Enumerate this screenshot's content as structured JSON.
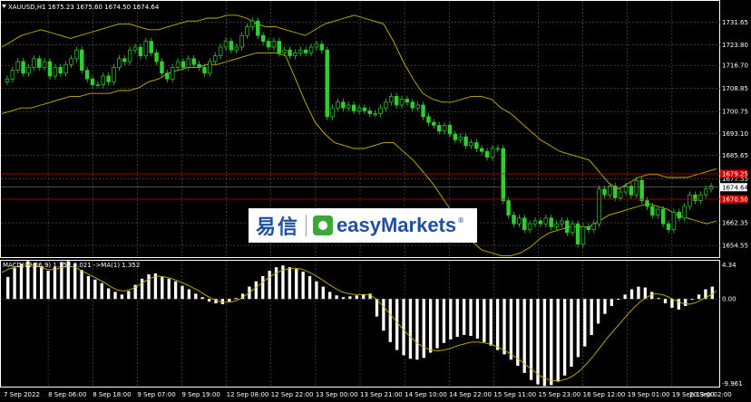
{
  "header": {
    "symbol_line": "XAUUSD,H1  1675.23 1675.60 1674.50 1674.64",
    "macd_line": "MACD(12,26,9) 1.352 0.021  ->MA(1) 1.352"
  },
  "logo": {
    "cn": "易信",
    "en": "easyMarkets",
    "reg": "®"
  },
  "colors": {
    "background": "#000000",
    "grid": "#5a5a5a",
    "candle": "#33cc33",
    "band": "#c8b400",
    "macd_hist": "#ffffff",
    "signal": "#c8b400",
    "hline": "#d40000",
    "price_label": "#ffffff",
    "red_label_bg": "#cc0000"
  },
  "price_axis_labels": [
    "1731.65",
    "1723.80",
    "1716.70",
    "1708.85",
    "1700.75",
    "1693.10",
    "1685.65",
    "1677.55",
    "1662.35",
    "1654.55"
  ],
  "price_tags": [
    {
      "value": "1679.25",
      "style": "red"
    },
    {
      "value": "1674.64",
      "style": "white"
    },
    {
      "value": "1670.50",
      "style": "red"
    }
  ],
  "macd_axis_labels": [
    "4.34",
    "0.00",
    "-9.961"
  ],
  "time_labels": [
    "7 Sep 2022",
    "8 Sep 06:00",
    "8 Sep 18:00",
    "9 Sep 07:00",
    "9 Sep 19:00",
    "12 Sep 08:00",
    "12 Sep 22:00",
    "13 Sep 00:00",
    "13 Sep 21:00",
    "14 Sep 10:00",
    "14 Sep 22:00",
    "15 Sep 11:00",
    "15 Sep 23:00",
    "16 Sep 12:00",
    "19 Sep 01:00",
    "19 Sep 13:00",
    "20 Sep 02:00"
  ],
  "chart_data": [
    {
      "type": "candlestick",
      "title": "XAUUSD,H1",
      "ylim": [
        1650.5,
        1735.5
      ],
      "grid": true,
      "horizontal_lines": [
        1679.25,
        1670.5
      ],
      "close": [
        1712,
        1715,
        1718,
        1714,
        1716,
        1719,
        1716,
        1718,
        1713,
        1716,
        1714,
        1717,
        1719,
        1722,
        1715,
        1712,
        1710,
        1710,
        1713,
        1711,
        1716,
        1719,
        1718,
        1722,
        1723,
        1720,
        1725,
        1721,
        1718,
        1714,
        1712,
        1716,
        1718,
        1716,
        1719,
        1717,
        1716,
        1714,
        1718,
        1720,
        1723,
        1725,
        1722,
        1723,
        1727,
        1730,
        1732,
        1727,
        1725,
        1723,
        1725,
        1721,
        1722,
        1720,
        1721,
        1722,
        1721,
        1723,
        1724,
        1722,
        1699,
        1702,
        1704,
        1702,
        1703,
        1701,
        1702,
        1701,
        1700,
        1700,
        1702,
        1704,
        1706,
        1703,
        1705,
        1704,
        1702,
        1703,
        1699,
        1697,
        1696,
        1694,
        1696,
        1693,
        1691,
        1692,
        1689,
        1690,
        1688,
        1687,
        1685,
        1688,
        1688,
        1670,
        1665,
        1662,
        1664,
        1660,
        1662,
        1663,
        1662,
        1664,
        1661,
        1662,
        1663,
        1659,
        1662,
        1655,
        1661,
        1660,
        1662,
        1674,
        1672,
        1675,
        1671,
        1673,
        1675,
        1672,
        1677,
        1670,
        1668,
        1665,
        1667,
        1662,
        1660,
        1666,
        1664,
        1668,
        1672,
        1670,
        1672,
        1674,
        1675
      ],
      "bollinger": {
        "upper": [
          1723,
          1725,
          1727,
          1728,
          1729,
          1728,
          1727,
          1726,
          1727,
          1728,
          1729,
          1730,
          1731,
          1731,
          1730,
          1729,
          1729,
          1730,
          1731,
          1732,
          1732,
          1733,
          1733,
          1734,
          1734,
          1733,
          1731,
          1730,
          1730,
          1729,
          1728,
          1727,
          1729,
          1731,
          1732,
          1733,
          1734,
          1733,
          1732,
          1731,
          1725,
          1718,
          1712,
          1707,
          1705,
          1704,
          1704,
          1705,
          1706,
          1706,
          1705,
          1702,
          1700,
          1697,
          1694,
          1691,
          1689,
          1687,
          1686,
          1685,
          1684,
          1680,
          1676,
          1674,
          1676,
          1678,
          1679,
          1679,
          1678,
          1678,
          1678,
          1679,
          1680,
          1681
        ],
        "lower": [
          1700,
          1701,
          1702,
          1702,
          1703,
          1704,
          1705,
          1706,
          1706,
          1707,
          1707,
          1707,
          1708,
          1708,
          1709,
          1711,
          1712,
          1714,
          1715,
          1716,
          1716,
          1717,
          1717,
          1718,
          1719,
          1720,
          1721,
          1721,
          1721,
          1720,
          1712,
          1704,
          1697,
          1693,
          1690,
          1689,
          1688,
          1688,
          1689,
          1690,
          1690,
          1687,
          1684,
          1680,
          1676,
          1671,
          1666,
          1660,
          1656,
          1653,
          1652,
          1651,
          1651,
          1652,
          1654,
          1657,
          1659,
          1660,
          1661,
          1661,
          1661,
          1663,
          1665,
          1666,
          1667,
          1668,
          1669,
          1668,
          1667,
          1665,
          1664,
          1663,
          1662,
          1663
        ]
      }
    },
    {
      "type": "bar",
      "title": "MACD(12,26,9)",
      "ylim": [
        -9.961,
        4.34
      ],
      "grid": true,
      "values": [
        2.5,
        3.5,
        4.0,
        4.3,
        4.1,
        3.7,
        3.2,
        3.6,
        4.2,
        4.3,
        4.0,
        3.3,
        2.6,
        2.2,
        1.8,
        1.2,
        0.8,
        0.5,
        0.9,
        1.6,
        2.3,
        2.8,
        2.9,
        2.5,
        2.3,
        2.0,
        1.5,
        1.1,
        0.6,
        0.2,
        -0.3,
        -0.5,
        -0.6,
        -0.3,
        0.1,
        0.6,
        1.4,
        2.0,
        2.6,
        3.2,
        3.6,
        3.8,
        3.6,
        3.4,
        3.1,
        2.6,
        2.0,
        1.4,
        0.8,
        0.4,
        0.2,
        0.3,
        0.4,
        0.5,
        0.6,
        -2.0,
        -3.6,
        -4.9,
        -5.8,
        -6.4,
        -6.8,
        -6.9,
        -6.7,
        -6.1,
        -5.6,
        -5.0,
        -4.6,
        -4.3,
        -4.1,
        -4.2,
        -4.5,
        -4.9,
        -5.3,
        -5.8,
        -6.3,
        -6.9,
        -7.6,
        -8.4,
        -9.2,
        -9.7,
        -9.9,
        -9.8,
        -9.4,
        -8.7,
        -7.7,
        -6.6,
        -5.4,
        -4.1,
        -2.8,
        -1.7,
        -0.8,
        -0.1,
        0.5,
        1.1,
        1.4,
        1.3,
        0.8,
        0.1,
        -0.5,
        -1.0,
        -1.2,
        -0.8,
        -0.1,
        0.5,
        1.1,
        1.4
      ],
      "signal": [
        3.0,
        3.4,
        3.6,
        3.8,
        3.9,
        3.8,
        3.5,
        3.3,
        3.4,
        3.6,
        3.7,
        3.5,
        3.1,
        2.7,
        2.3,
        1.9,
        1.4,
        1.0,
        0.9,
        1.1,
        1.5,
        2.0,
        2.4,
        2.6,
        2.5,
        2.3,
        2.0,
        1.7,
        1.3,
        0.9,
        0.4,
        0.0,
        -0.3,
        -0.4,
        -0.3,
        0.0,
        0.5,
        1.1,
        1.7,
        2.3,
        2.8,
        3.2,
        3.4,
        3.5,
        3.4,
        3.1,
        2.7,
        2.2,
        1.7,
        1.2,
        0.8,
        0.6,
        0.5,
        0.5,
        0.5,
        0.0,
        -0.8,
        -1.7,
        -2.6,
        -3.5,
        -4.3,
        -5.0,
        -5.5,
        -5.8,
        -5.9,
        -5.8,
        -5.6,
        -5.3,
        -5.1,
        -4.9,
        -4.9,
        -5.0,
        -5.2,
        -5.5,
        -5.9,
        -6.4,
        -6.9,
        -7.5,
        -8.1,
        -8.7,
        -9.1,
        -9.3,
        -9.3,
        -9.1,
        -8.7,
        -8.1,
        -7.3,
        -6.4,
        -5.4,
        -4.4,
        -3.5,
        -2.6,
        -1.7,
        -0.9,
        -0.2,
        0.3,
        0.6,
        0.5,
        0.2,
        -0.2,
        -0.5,
        -0.6,
        -0.4,
        0.0,
        0.4,
        0.9
      ]
    }
  ]
}
